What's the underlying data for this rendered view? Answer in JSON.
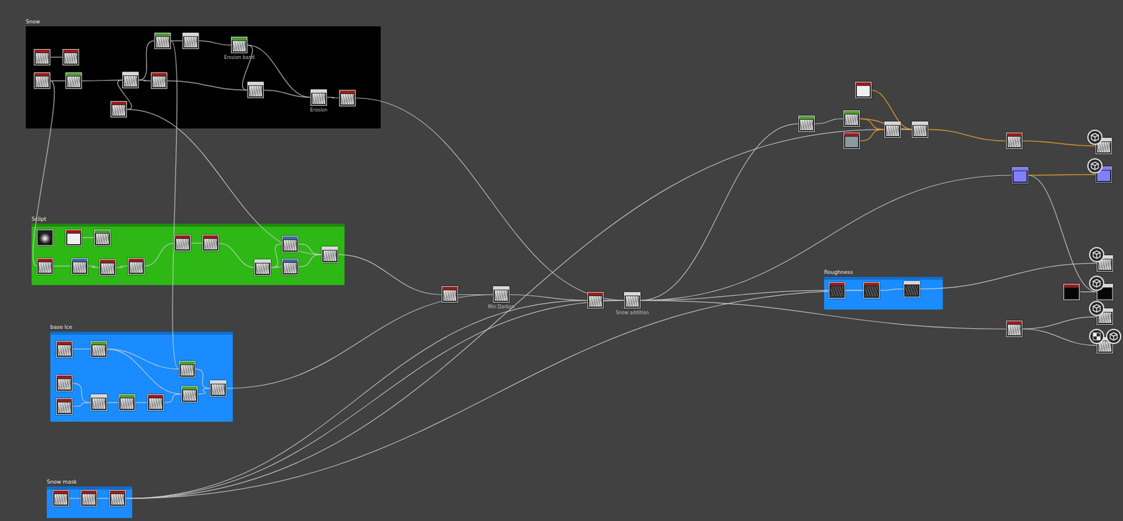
{
  "frames": [
    {
      "title": "Snow",
      "color": "#000000"
    },
    {
      "title": "Sclipt",
      "color": "#2eb816"
    },
    {
      "title": "base Ice",
      "color": "#1a8cff"
    },
    {
      "title": "Snow mask",
      "color": "#1a8cff"
    },
    {
      "title": "Roughness",
      "color": "#1a8cff"
    }
  ],
  "nodes": [
    {
      "label": "",
      "color": "#9b1c1c",
      "kind": "noise"
    },
    {
      "label": "",
      "color": "#9b1c1c",
      "kind": "noise"
    },
    {
      "label": "",
      "color": "#9b1c1c",
      "kind": "noise"
    },
    {
      "label": "",
      "color": "#4aa02c",
      "kind": "noise"
    },
    {
      "label": "",
      "color": "#d8d8d8",
      "kind": "noise"
    },
    {
      "label": "",
      "color": "#9b1c1c",
      "kind": "noise"
    },
    {
      "label": "",
      "color": "#4aa02c",
      "kind": "noise"
    },
    {
      "label": "",
      "color": "#d8d8d8",
      "kind": "noise"
    },
    {
      "label": "Erosion band",
      "color": "#4aa02c",
      "kind": "noise"
    },
    {
      "label": "",
      "color": "#9b1c1c",
      "kind": "noise"
    },
    {
      "label": "",
      "color": "#d8d8d8",
      "kind": "noise"
    },
    {
      "label": "Erosion",
      "color": "#d8d8d8",
      "kind": "noise"
    },
    {
      "label": "",
      "color": "#9b1c1c",
      "kind": "noise"
    },
    {
      "label": "",
      "color": "#222222",
      "kind": "radial"
    },
    {
      "label": "",
      "color": "#9b1c1c",
      "kind": "white"
    },
    {
      "label": "",
      "color": "#4aa02c",
      "kind": "noise"
    },
    {
      "label": "",
      "color": "#9b1c1c",
      "kind": "noise"
    },
    {
      "label": "",
      "color": "#3b6aa0",
      "kind": "noise"
    },
    {
      "label": "",
      "color": "#9b1c1c",
      "kind": "noise"
    },
    {
      "label": "",
      "color": "#9b1c1c",
      "kind": "noise"
    },
    {
      "label": "",
      "color": "#9b1c1c",
      "kind": "noise"
    },
    {
      "label": "",
      "color": "#9b1c1c",
      "kind": "noise"
    },
    {
      "label": "",
      "color": "#d8d8d8",
      "kind": "noise"
    },
    {
      "label": "",
      "color": "#3b6aa0",
      "kind": "noise"
    },
    {
      "label": "",
      "color": "#3b6aa0",
      "kind": "noise"
    },
    {
      "label": "",
      "color": "#d8d8d8",
      "kind": "noise"
    },
    {
      "label": "",
      "color": "#9b1c1c",
      "kind": "noise"
    },
    {
      "label": "",
      "color": "#4aa02c",
      "kind": "noise"
    },
    {
      "label": "",
      "color": "#9b1c1c",
      "kind": "noise"
    },
    {
      "label": "",
      "color": "#9b1c1c",
      "kind": "noise"
    },
    {
      "label": "",
      "color": "#d8d8d8",
      "kind": "noise"
    },
    {
      "label": "",
      "color": "#4aa02c",
      "kind": "noise"
    },
    {
      "label": "",
      "color": "#9b1c1c",
      "kind": "noise"
    },
    {
      "label": "",
      "color": "#4aa02c",
      "kind": "noise"
    },
    {
      "label": "",
      "color": "#4aa02c",
      "kind": "noise"
    },
    {
      "label": "",
      "color": "#d8d8d8",
      "kind": "noise"
    },
    {
      "label": "",
      "color": "#9b1c1c",
      "kind": "noise"
    },
    {
      "label": "",
      "color": "#9b1c1c",
      "kind": "noise"
    },
    {
      "label": "",
      "color": "#9b1c1c",
      "kind": "noise"
    },
    {
      "label": "",
      "color": "#9b1c1c",
      "kind": "noise"
    },
    {
      "label": "Min Darken",
      "color": "#d8d8d8",
      "kind": "noise"
    },
    {
      "label": "",
      "color": "#9b1c1c",
      "kind": "noise"
    },
    {
      "label": "Snow addition",
      "color": "#d8d8d8",
      "kind": "noise"
    },
    {
      "label": "",
      "color": "#9b1c1c",
      "kind": "dark"
    },
    {
      "label": "",
      "color": "#9b1c1c",
      "kind": "dark"
    },
    {
      "label": "",
      "color": "#d8d8d8",
      "kind": "dark"
    },
    {
      "label": "",
      "color": "#9b1c1c",
      "kind": "white"
    },
    {
      "label": "",
      "color": "#4aa02c",
      "kind": "noise"
    },
    {
      "label": "",
      "color": "#4aa02c",
      "kind": "noise"
    },
    {
      "label": "",
      "color": "#9b1c1c",
      "kind": "grey"
    },
    {
      "label": "",
      "color": "#d8d8d8",
      "kind": "noise"
    },
    {
      "label": "",
      "color": "#d8d8d8",
      "kind": "noise"
    },
    {
      "label": "",
      "color": "#9b1c1c",
      "kind": "noise"
    },
    {
      "label": "",
      "color": "#7f7fff",
      "kind": "purple"
    },
    {
      "label": "",
      "color": "#9b1c1c",
      "kind": "black"
    },
    {
      "label": "",
      "color": "#9b1c1c",
      "kind": "noise"
    },
    {
      "label": "",
      "color": "#d8d8d8",
      "kind": "noise"
    },
    {
      "label": "",
      "color": "#7f7fff",
      "kind": "purple"
    },
    {
      "label": "",
      "color": "#d8d8d8",
      "kind": "noise"
    },
    {
      "label": "",
      "color": "#d8d8d8",
      "kind": "black"
    },
    {
      "label": "",
      "color": "#d8d8d8",
      "kind": "noise"
    },
    {
      "label": "",
      "color": "#d8d8d8",
      "kind": "noise"
    }
  ],
  "edges": [
    {
      "from": 0,
      "to": 1,
      "color": "#cfcfcf"
    },
    {
      "from": 2,
      "to": 3,
      "color": "#cfcfcf"
    },
    {
      "from": 3,
      "to": 4,
      "color": "#cfcfcf"
    },
    {
      "from": 9,
      "to": 4,
      "color": "#cfcfcf"
    },
    {
      "from": 4,
      "to": 5,
      "color": "#cfcfcf"
    },
    {
      "from": 5,
      "to": 10,
      "color": "#cfcfcf"
    },
    {
      "from": 4,
      "to": 6,
      "color": "#cfcfcf"
    },
    {
      "from": 6,
      "to": 7,
      "color": "#cfcfcf"
    },
    {
      "from": 7,
      "to": 8,
      "color": "#cfcfcf"
    },
    {
      "from": 8,
      "to": 10,
      "color": "#cfcfcf"
    },
    {
      "from": 10,
      "to": 11,
      "color": "#cfcfcf"
    },
    {
      "from": 8,
      "to": 11,
      "color": "#cfcfcf"
    },
    {
      "from": 11,
      "to": 12,
      "color": "#cfcfcf"
    },
    {
      "from": 12,
      "to": 42,
      "color": "#cfcfcf"
    },
    {
      "from": 2,
      "to": 16,
      "color": "#cfcfcf"
    },
    {
      "from": 9,
      "to": 25,
      "color": "#cfcfcf"
    },
    {
      "from": 14,
      "to": 15,
      "color": "#cfcfcf"
    },
    {
      "from": 16,
      "to": 17,
      "color": "#cfcfcf"
    },
    {
      "from": 17,
      "to": 18,
      "color": "#cfcfcf"
    },
    {
      "from": 18,
      "to": 19,
      "color": "#cfcfcf"
    },
    {
      "from": 19,
      "to": 20,
      "color": "#cfcfcf"
    },
    {
      "from": 20,
      "to": 21,
      "color": "#cfcfcf"
    },
    {
      "from": 21,
      "to": 22,
      "color": "#cfcfcf"
    },
    {
      "from": 22,
      "to": 23,
      "color": "#cfcfcf"
    },
    {
      "from": 22,
      "to": 24,
      "color": "#cfcfcf"
    },
    {
      "from": 23,
      "to": 25,
      "color": "#cfcfcf"
    },
    {
      "from": 24,
      "to": 25,
      "color": "#cfcfcf"
    },
    {
      "from": 6,
      "to": 33,
      "color": "#cfcfcf"
    },
    {
      "from": 25,
      "to": 39,
      "color": "#cfcfcf"
    },
    {
      "from": 39,
      "to": 40,
      "color": "#cfcfcf"
    },
    {
      "from": 35,
      "to": 40,
      "color": "#cfcfcf"
    },
    {
      "from": 40,
      "to": 41,
      "color": "#cfcfcf"
    },
    {
      "from": 41,
      "to": 42,
      "color": "#cfcfcf"
    },
    {
      "from": 26,
      "to": 27,
      "color": "#cfcfcf"
    },
    {
      "from": 27,
      "to": 33,
      "color": "#cfcfcf"
    },
    {
      "from": 28,
      "to": 30,
      "color": "#cfcfcf"
    },
    {
      "from": 29,
      "to": 30,
      "color": "#cfcfcf"
    },
    {
      "from": 30,
      "to": 31,
      "color": "#cfcfcf"
    },
    {
      "from": 31,
      "to": 32,
      "color": "#cfcfcf"
    },
    {
      "from": 32,
      "to": 34,
      "color": "#cfcfcf"
    },
    {
      "from": 33,
      "to": 35,
      "color": "#cfcfcf"
    },
    {
      "from": 34,
      "to": 35,
      "color": "#cfcfcf"
    },
    {
      "from": 27,
      "to": 34,
      "color": "#cfcfcf"
    },
    {
      "from": 36,
      "to": 37,
      "color": "#cfcfcf"
    },
    {
      "from": 37,
      "to": 38,
      "color": "#cfcfcf"
    },
    {
      "from": 38,
      "to": 42,
      "color": "#cfcfcf"
    },
    {
      "from": 38,
      "to": 50,
      "color": "#cfcfcf"
    },
    {
      "from": 38,
      "to": 44,
      "color": "#cfcfcf"
    },
    {
      "from": 38,
      "to": 41,
      "color": "#cfcfcf"
    },
    {
      "from": 42,
      "to": 47,
      "color": "#cfcfcf"
    },
    {
      "from": 42,
      "to": 53,
      "color": "#cfcfcf"
    },
    {
      "from": 42,
      "to": 43,
      "color": "#cfcfcf"
    },
    {
      "from": 42,
      "to": 55,
      "color": "#cfcfcf"
    },
    {
      "from": 47,
      "to": 48,
      "color": "#cfcfcf"
    },
    {
      "from": 48,
      "to": 50,
      "color": "#d89a2a"
    },
    {
      "from": 46,
      "to": 51,
      "color": "#d89a2a"
    },
    {
      "from": 49,
      "to": 50,
      "color": "#d89a2a"
    },
    {
      "from": 48,
      "to": 51,
      "color": "#d89a2a"
    },
    {
      "from": 50,
      "to": 51,
      "color": "#cfcfcf"
    },
    {
      "from": 51,
      "to": 52,
      "color": "#d89a2a"
    },
    {
      "from": 52,
      "to": 56,
      "color": "#d89a2a"
    },
    {
      "from": 53,
      "to": 57,
      "color": "#d89a2a"
    },
    {
      "from": 54,
      "to": 59,
      "color": "#cfcfcf"
    },
    {
      "from": 53,
      "to": 59,
      "color": "#cfcfcf"
    },
    {
      "from": 43,
      "to": 44,
      "color": "#cfcfcf"
    },
    {
      "from": 44,
      "to": 45,
      "color": "#cfcfcf"
    },
    {
      "from": 45,
      "to": 58,
      "color": "#cfcfcf"
    },
    {
      "from": 55,
      "to": 60,
      "color": "#cfcfcf"
    },
    {
      "from": 55,
      "to": 61,
      "color": "#cfcfcf"
    }
  ]
}
